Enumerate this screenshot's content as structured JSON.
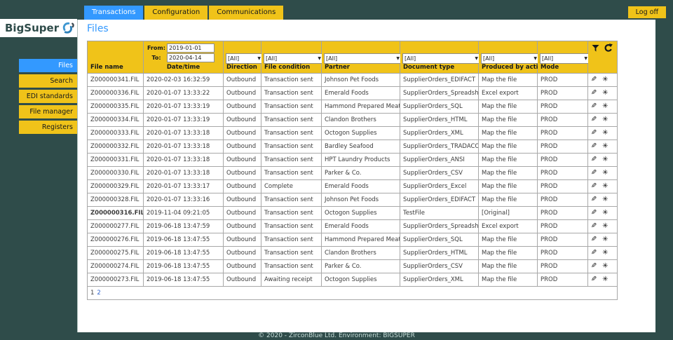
{
  "brand": {
    "name": "BigSuper"
  },
  "topnav": {
    "tabs": [
      {
        "label": "Transactions",
        "active": true
      },
      {
        "label": "Configuration",
        "active": false
      },
      {
        "label": "Communications",
        "active": false
      }
    ],
    "logoff_label": "Log off"
  },
  "sidebar": {
    "items": [
      {
        "label": "Files",
        "active": true
      },
      {
        "label": "Search",
        "active": false
      },
      {
        "label": "EDI standards",
        "active": false
      },
      {
        "label": "File manager",
        "active": false
      },
      {
        "label": "Registers",
        "active": false
      }
    ]
  },
  "page": {
    "title": "Files"
  },
  "filters": {
    "from_label": "From:",
    "from_value": "2019-01-01",
    "to_label": "To:",
    "to_value": "2020-04-14",
    "all_label": "[All]"
  },
  "table": {
    "columns": [
      "File name",
      "Date/time",
      "Direction",
      "File condition",
      "Partner",
      "Document type",
      "Produced by action",
      "Mode"
    ],
    "rows": [
      {
        "file": "Z000000341.FIL",
        "datetime": "2020-02-03 16:32:59",
        "direction": "Outbound",
        "condition": "Transaction sent",
        "partner": "Johnson Pet Foods",
        "doctype": "SupplierOrders_EDIFACT",
        "action": "Map the file",
        "mode": "PROD",
        "bold": false
      },
      {
        "file": "Z000000336.FIL",
        "datetime": "2020-01-07 13:33:22",
        "direction": "Outbound",
        "condition": "Transaction sent",
        "partner": "Emerald Foods",
        "doctype": "SupplierOrders_Spreadsheet",
        "action": "Excel export",
        "mode": "PROD",
        "bold": false
      },
      {
        "file": "Z000000335.FIL",
        "datetime": "2020-01-07 13:33:19",
        "direction": "Outbound",
        "condition": "Transaction sent",
        "partner": "Hammond Prepared Meats",
        "doctype": "SupplierOrders_SQL",
        "action": "Map the file",
        "mode": "PROD",
        "bold": false
      },
      {
        "file": "Z000000334.FIL",
        "datetime": "2020-01-07 13:33:19",
        "direction": "Outbound",
        "condition": "Transaction sent",
        "partner": "Clandon Brothers",
        "doctype": "SupplierOrders_HTML",
        "action": "Map the file",
        "mode": "PROD",
        "bold": false
      },
      {
        "file": "Z000000333.FIL",
        "datetime": "2020-01-07 13:33:18",
        "direction": "Outbound",
        "condition": "Transaction sent",
        "partner": "Octogon Supplies",
        "doctype": "SupplierOrders_XML",
        "action": "Map the file",
        "mode": "PROD",
        "bold": false
      },
      {
        "file": "Z000000332.FIL",
        "datetime": "2020-01-07 13:33:18",
        "direction": "Outbound",
        "condition": "Transaction sent",
        "partner": "Bardley Seafood",
        "doctype": "SupplierOrders_TRADACOMS",
        "action": "Map the file",
        "mode": "PROD",
        "bold": false
      },
      {
        "file": "Z000000331.FIL",
        "datetime": "2020-01-07 13:33:18",
        "direction": "Outbound",
        "condition": "Transaction sent",
        "partner": "HPT Laundry Products",
        "doctype": "SupplierOrders_ANSI",
        "action": "Map the file",
        "mode": "PROD",
        "bold": false
      },
      {
        "file": "Z000000330.FIL",
        "datetime": "2020-01-07 13:33:18",
        "direction": "Outbound",
        "condition": "Transaction sent",
        "partner": "Parker & Co.",
        "doctype": "SupplierOrders_CSV",
        "action": "Map the file",
        "mode": "PROD",
        "bold": false
      },
      {
        "file": "Z000000329.FIL",
        "datetime": "2020-01-07 13:33:17",
        "direction": "Outbound",
        "condition": "Complete",
        "partner": "Emerald Foods",
        "doctype": "SupplierOrders_Excel",
        "action": "Map the file",
        "mode": "PROD",
        "bold": false
      },
      {
        "file": "Z000000328.FIL",
        "datetime": "2020-01-07 13:33:16",
        "direction": "Outbound",
        "condition": "Transaction sent",
        "partner": "Johnson Pet Foods",
        "doctype": "SupplierOrders_EDIFACT",
        "action": "Map the file",
        "mode": "PROD",
        "bold": false
      },
      {
        "file": "Z000000316.FIL",
        "datetime": "2019-11-04 09:21:05",
        "direction": "Outbound",
        "condition": "Transaction sent",
        "partner": "Octogon Supplies",
        "doctype": "TestFile",
        "action": "[Original]",
        "mode": "PROD",
        "bold": true
      },
      {
        "file": "Z000000277.FIL",
        "datetime": "2019-06-18 13:47:59",
        "direction": "Outbound",
        "condition": "Transaction sent",
        "partner": "Emerald Foods",
        "doctype": "SupplierOrders_Spreadsheet",
        "action": "Excel export",
        "mode": "PROD",
        "bold": false
      },
      {
        "file": "Z000000276.FIL",
        "datetime": "2019-06-18 13:47:55",
        "direction": "Outbound",
        "condition": "Transaction sent",
        "partner": "Hammond Prepared Meats",
        "doctype": "SupplierOrders_SQL",
        "action": "Map the file",
        "mode": "PROD",
        "bold": false
      },
      {
        "file": "Z000000275.FIL",
        "datetime": "2019-06-18 13:47:55",
        "direction": "Outbound",
        "condition": "Transaction sent",
        "partner": "Clandon Brothers",
        "doctype": "SupplierOrders_HTML",
        "action": "Map the file",
        "mode": "PROD",
        "bold": false
      },
      {
        "file": "Z000000274.FIL",
        "datetime": "2019-06-18 13:47:55",
        "direction": "Outbound",
        "condition": "Transaction sent",
        "partner": "Parker & Co.",
        "doctype": "SupplierOrders_CSV",
        "action": "Map the file",
        "mode": "PROD",
        "bold": false
      },
      {
        "file": "Z000000273.FIL",
        "datetime": "2019-06-18 13:47:55",
        "direction": "Outbound",
        "condition": "Awaiting receipt",
        "partner": "Octogon Supplies",
        "doctype": "SupplierOrders_XML",
        "action": "Map the file",
        "mode": "PROD",
        "bold": false
      }
    ]
  },
  "pagination": {
    "current": "1",
    "next": "2"
  },
  "icons": {
    "edit_glyph": "✎",
    "process_glyph": "✳",
    "select_arrow": "▼",
    "filter": "funnel",
    "refresh": "circular-arrow"
  },
  "footer": {
    "text": "© 2020 - ZirconBlue Ltd. Environment: BIGSUPER"
  },
  "colors": {
    "accent_yellow": "#F0C319",
    "accent_blue": "#3399FF",
    "background_teal": "#2F4C4A"
  }
}
